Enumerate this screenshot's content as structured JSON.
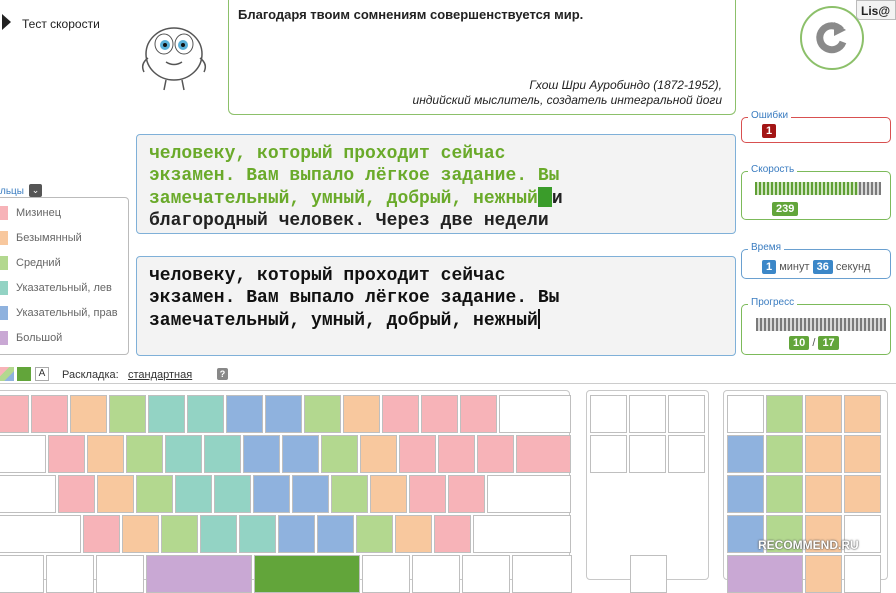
{
  "nav": {
    "label": "Тест скорости"
  },
  "user": {
    "name": "Lis@"
  },
  "quote": {
    "text": "Благодаря твоим сомнениям совершенствуется мир.",
    "author": "Гхош Шри Ауробиндо (1872-1952),",
    "origin": "индийский мыслитель, создатель интегральной йоги"
  },
  "icons": {
    "nav": "play-arrow-icon",
    "restart": "restart-icon",
    "mascot": "mascot-icon",
    "help": "help-icon"
  },
  "stats": {
    "errors": {
      "label": "Ошибки",
      "value": "1"
    },
    "speed": {
      "label": "Скорость",
      "value": "239",
      "level": 0.82
    },
    "time": {
      "label": "Время",
      "minutes": "1",
      "minutes_unit": "минут",
      "seconds": "36",
      "seconds_unit": "секунд"
    },
    "progress": {
      "label": "Прогресс",
      "done": "10",
      "sep": "/",
      "total": "17"
    }
  },
  "exercise": {
    "typed_lines": [
      "человеку, который проходит сейчас",
      "экзамен. Вам выпало лёгкое задание. Вы",
      "замечательный, умный, добрый, нежный"
    ],
    "current_char": " ",
    "rest_line3": "и",
    "line4": "благородный человек. Через две недели"
  },
  "input": {
    "lines": [
      "человеку, который проходит сейчас",
      "экзамен. Вам выпало лёгкое задание. Вы",
      "замечательный, умный, добрый, нежный"
    ]
  },
  "legend": {
    "title": "льцы",
    "items": [
      {
        "label": "Мизинец",
        "color": "#f7b3b8"
      },
      {
        "label": "Безымянный",
        "color": "#f8c89e"
      },
      {
        "label": "Средний",
        "color": "#b3d88f"
      },
      {
        "label": "Указательный, лев",
        "color": "#93d3c4"
      },
      {
        "label": "Указательный, прав",
        "color": "#8fb2de"
      },
      {
        "label": "Большой",
        "color": "#c9a8d4"
      }
    ]
  },
  "layout": {
    "label": "Раскладка:",
    "value": "стандартная",
    "letter_toggle": "A",
    "help": "?"
  },
  "watermark": "RECOMMEND.RU",
  "colors": {
    "accent_green": "#6aaa2a",
    "panel_blue": "#3a7cc0",
    "error_red": "#a31515"
  }
}
